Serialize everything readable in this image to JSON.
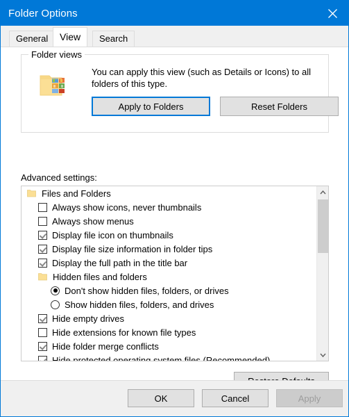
{
  "window": {
    "title": "Folder Options",
    "close_icon": "close-icon",
    "accent_color": "#0078d7"
  },
  "tabs": [
    {
      "label": "General",
      "selected": false
    },
    {
      "label": "View",
      "selected": true
    },
    {
      "label": "Search",
      "selected": false
    }
  ],
  "folder_views": {
    "legend": "Folder views",
    "icon": "folder-views-icon",
    "description": "You can apply this view (such as Details or Icons) to all folders of this type.",
    "apply_to_folders_label": "Apply to Folders",
    "reset_folders_label": "Reset Folders"
  },
  "advanced": {
    "label": "Advanced settings:",
    "items": [
      {
        "type": "group",
        "indent": 0,
        "label": "Files and Folders",
        "icon": "folder-icon"
      },
      {
        "type": "checkbox",
        "indent": 1,
        "label": "Always show icons, never thumbnails",
        "checked": false
      },
      {
        "type": "checkbox",
        "indent": 1,
        "label": "Always show menus",
        "checked": false
      },
      {
        "type": "checkbox",
        "indent": 1,
        "label": "Display file icon on thumbnails",
        "checked": true
      },
      {
        "type": "checkbox",
        "indent": 1,
        "label": "Display file size information in folder tips",
        "checked": true
      },
      {
        "type": "checkbox",
        "indent": 1,
        "label": "Display the full path in the title bar",
        "checked": true
      },
      {
        "type": "group",
        "indent": 1,
        "label": "Hidden files and folders",
        "icon": "folder-icon"
      },
      {
        "type": "radio",
        "indent": 2,
        "label": "Don't show hidden files, folders, or drives",
        "checked": true
      },
      {
        "type": "radio",
        "indent": 2,
        "label": "Show hidden files, folders, and drives",
        "checked": false
      },
      {
        "type": "checkbox",
        "indent": 1,
        "label": "Hide empty drives",
        "checked": true
      },
      {
        "type": "checkbox",
        "indent": 1,
        "label": "Hide extensions for known file types",
        "checked": false
      },
      {
        "type": "checkbox",
        "indent": 1,
        "label": "Hide folder merge conflicts",
        "checked": true
      },
      {
        "type": "checkbox",
        "indent": 1,
        "label": "Hide protected operating system files (Recommended)",
        "checked": true
      },
      {
        "type": "checkbox",
        "indent": 1,
        "label": "",
        "checked": false,
        "clipped": true
      }
    ],
    "scrollbar": {
      "up_arrow_icon": "chevron-up-icon",
      "down_arrow_icon": "chevron-down-icon"
    },
    "restore_defaults_label": "Restore Defaults"
  },
  "footer": {
    "ok_label": "OK",
    "cancel_label": "Cancel",
    "apply_label": "Apply",
    "apply_disabled": true
  }
}
